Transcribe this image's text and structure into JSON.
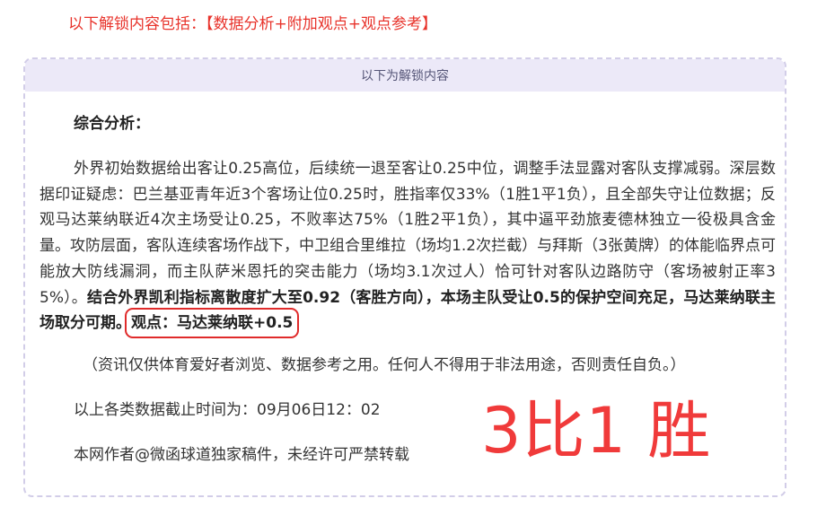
{
  "headline": "以下解锁内容包括：【数据分析+附加观点+观点参考】",
  "card": {
    "header": "以下为解锁内容",
    "section_title": "综合分析：",
    "analysis_plain": "外界初始数据给出客让0.25高位，后续统一退至客让0.25中位，调整手法显露对客队支撑减弱。深层数据印证疑虑：巴兰基亚青年近3个客场让位0.25时，胜指率仅33%（1胜1平1负），且全部失守让位数据；反观马达莱纳联近4次主场受让0.25，不败率达75%（1胜2平1负），其中逼平劲旅麦德林独立一役极具含金量。攻防层面，客队连续客场作战下，中卫组合里维拉（场均1.2次拦截）与拜斯（3张黄牌）的体能临界点可能放大防线漏洞，而主队萨米恩托的突击能力（场均3.1次过人）恰可针对客队边路防守（客场被射正率35%）。",
    "analysis_bold": "结合外界凯利指标离散度扩大至0.92（客胜方向），本场主队受让0.5的保护空间充足，马达莱纳联主场取分可期。",
    "viewpoint": "观点：马达莱纳联+0.5",
    "disclaimer": "（资讯仅供体育爱好者浏览、数据参考之用。任何人不得用于非法用途，否则责任自负。）",
    "deadline": "以上各类数据截止时间为：09月06日12：02",
    "copyright": "本网作者@微函球道独家稿件，未经许可严禁转载"
  },
  "score_overlay": "3比1 胜",
  "colors": {
    "accent_red": "#e8332b",
    "header_bg": "#ece9f8",
    "border": "#d2cde8"
  }
}
